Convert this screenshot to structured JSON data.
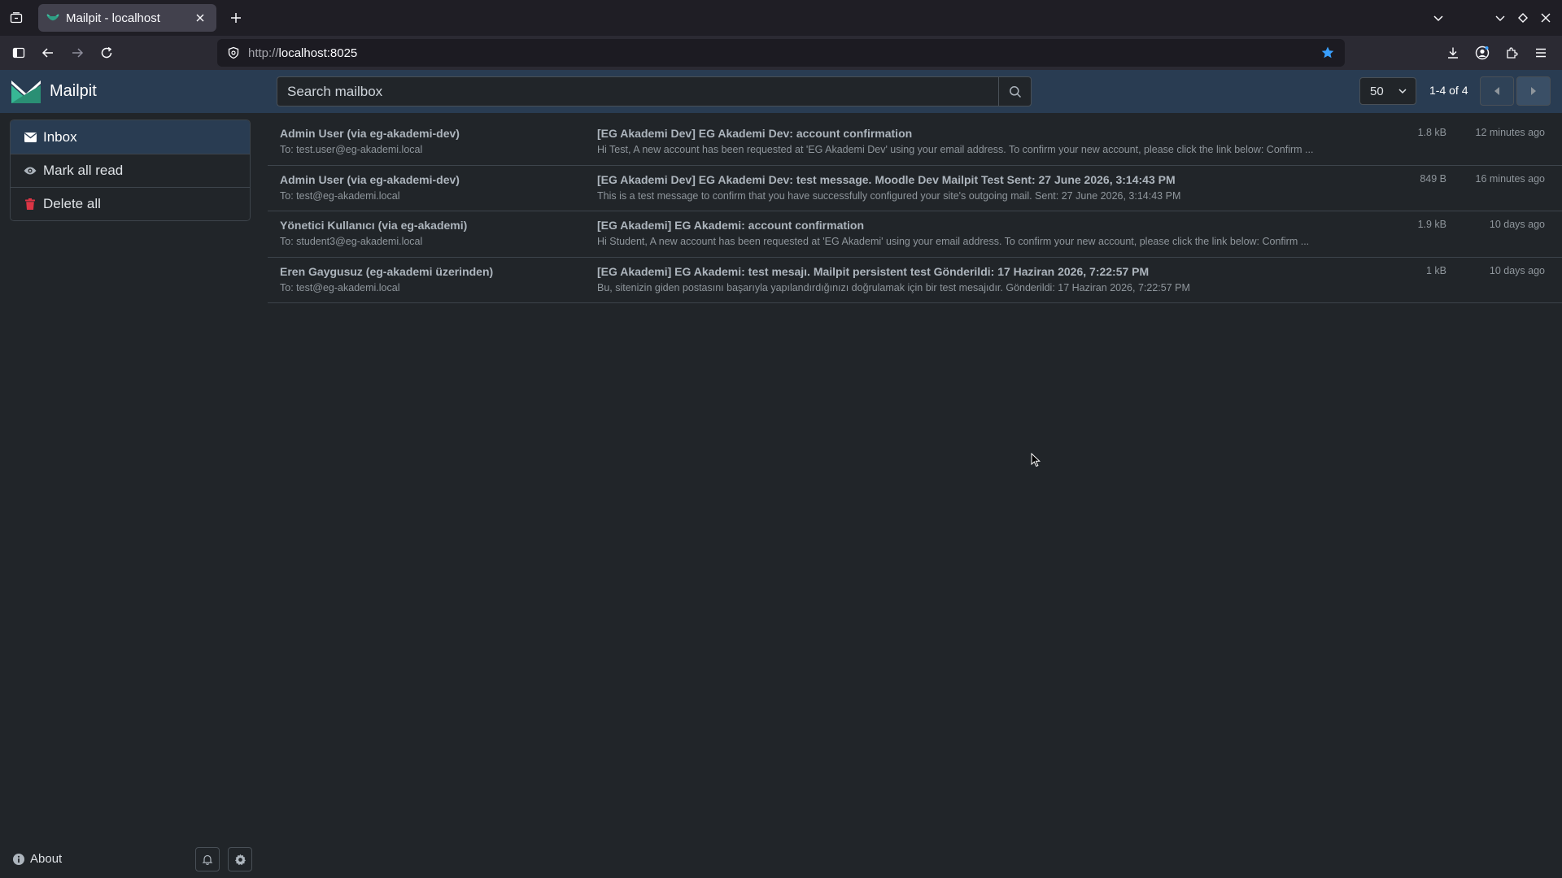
{
  "browser": {
    "tab_title": "Mailpit - localhost",
    "url_protocol": "http://",
    "url_host": "localhost:8025"
  },
  "app": {
    "name": "Mailpit",
    "search_placeholder": "Search mailbox",
    "per_page": "50",
    "page_info": "1-4 of 4"
  },
  "sidebar": {
    "items": [
      {
        "label": "Inbox",
        "icon": "envelope-icon",
        "active": true
      },
      {
        "label": "Mark all read",
        "icon": "eye-icon",
        "active": false
      },
      {
        "label": "Delete all",
        "icon": "trash-icon",
        "active": false
      }
    ],
    "about_label": "About"
  },
  "messages": [
    {
      "from": "Admin User (via eg-akademi-dev)",
      "to": "To: test.user@eg-akademi.local",
      "subject": "[EG Akademi Dev] EG Akademi Dev: account confirmation",
      "snippet": "Hi Test, A new account has been requested at 'EG Akademi Dev' using your email address. To confirm your new account, please click the link below: Confirm ...",
      "size": "1.8 kB",
      "time": "12 minutes ago"
    },
    {
      "from": "Admin User (via eg-akademi-dev)",
      "to": "To: test@eg-akademi.local",
      "subject": "[EG Akademi Dev] EG Akademi Dev: test message. Moodle Dev Mailpit Test Sent: 27 June 2026, 3:14:43 PM",
      "snippet": "This is a test message to confirm that you have successfully configured your site's outgoing mail. Sent: 27 June 2026, 3:14:43 PM",
      "size": "849 B",
      "time": "16 minutes ago"
    },
    {
      "from": "Yönetici Kullanıcı (via eg-akademi)",
      "to": "To: student3@eg-akademi.local",
      "subject": "[EG Akademi] EG Akademi: account confirmation",
      "snippet": "Hi Student, A new account has been requested at 'EG Akademi' using your email address. To confirm your new account, please click the link below: Confirm ...",
      "size": "1.9 kB",
      "time": "10 days ago"
    },
    {
      "from": "Eren Gaygusuz (eg-akademi üzerinden)",
      "to": "To: test@eg-akademi.local",
      "subject": "[EG Akademi] EG Akademi: test mesajı. Mailpit persistent test Gönderildi: 17 Haziran 2026, 7:22:57 PM",
      "snippet": "Bu, sitenizin giden postasını başarıyla yapılandırdığınızı doğrulamak için bir test mesajıdır. Gönderildi: 17 Haziran 2026, 7:22:57 PM",
      "size": "1 kB",
      "time": "10 days ago"
    }
  ],
  "colors": {
    "header_bg": "#293c52",
    "page_bg": "#212529",
    "accent_star": "#3aa0ff",
    "trash": "#dc3545"
  }
}
